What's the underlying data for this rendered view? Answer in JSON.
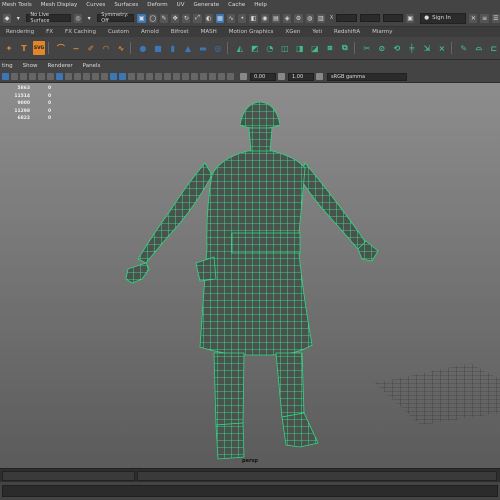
{
  "menubar": {
    "items": [
      "Mesh Tools",
      "Mesh Display",
      "Curves",
      "Surfaces",
      "Deform",
      "UV",
      "Generate",
      "Cache",
      "Help"
    ]
  },
  "statusline": {
    "live_surface": "No Live Surface",
    "symmetry": "Symmetry: Off",
    "x_label": "X",
    "sign_in": "Sign In"
  },
  "shelf_tabs": [
    "Rendering",
    "FX",
    "FX Caching",
    "Custom",
    "Arnold",
    "Bifrost",
    "MASH",
    "Motion Graphics",
    "XGen",
    "Yeti",
    "RedshiftA",
    "Miarmy"
  ],
  "shelf": {
    "text_icon": "T",
    "svg_icon": "SVG"
  },
  "panel_menu": {
    "items": [
      "ting",
      "Show",
      "Renderer",
      "Panels"
    ]
  },
  "panel_toolbar": {
    "exposure": "0.00",
    "gamma": "1.00",
    "color_space": "sRGB gamma"
  },
  "hud": {
    "rows": [
      [
        "5863",
        "0"
      ],
      [
        "11514",
        "0"
      ],
      [
        "9000",
        "0"
      ],
      [
        "11298",
        "0"
      ],
      [
        "6822",
        "0"
      ]
    ]
  },
  "viewport": {
    "camera": "persp",
    "wire_color": "#41f29a"
  },
  "colors": {
    "accent_orange": "#e3862b",
    "accent_green": "#3fbf86",
    "accent_blue": "#3d76b5",
    "background_top": "#8a8a8a"
  }
}
